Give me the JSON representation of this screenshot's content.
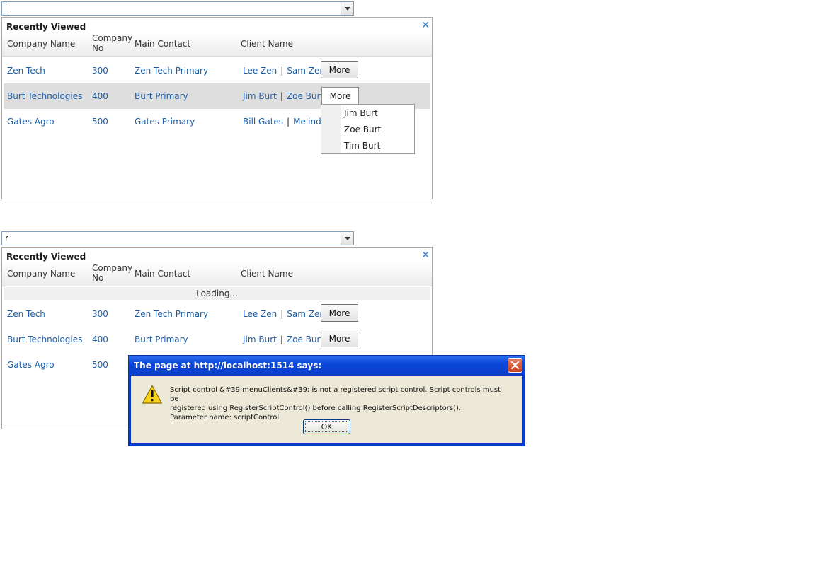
{
  "panel_top": {
    "search": {
      "value": ""
    },
    "title": "Recently Viewed",
    "columns": [
      "Company Name",
      "Company No",
      "Main Contact",
      "Client Name"
    ],
    "rows": [
      {
        "company": "Zen Tech",
        "no": "300",
        "contact": "Zen Tech Primary",
        "client1": "Lee Zen",
        "client2": "Sam Zen",
        "more": "More"
      },
      {
        "company": "Burt Technologies",
        "no": "400",
        "contact": "Burt Primary",
        "client1": "Jim Burt",
        "client2": "Zoe Burt",
        "more": "More"
      },
      {
        "company": "Gates Agro",
        "no": "500",
        "contact": "Gates Primary",
        "client1": "Bill Gates",
        "client2": "Melinda G"
      }
    ],
    "menu": [
      "Jim Burt",
      "Zoe Burt",
      "Tim Burt"
    ]
  },
  "panel_bottom": {
    "search": {
      "value": "r"
    },
    "title": "Recently Viewed",
    "columns": [
      "Company Name",
      "Company No",
      "Main Contact",
      "Client Name"
    ],
    "loading": "Loading...",
    "rows": [
      {
        "company": "Zen Tech",
        "no": "300",
        "contact": "Zen Tech Primary",
        "client1": "Lee Zen",
        "client2": "Sam Zen",
        "more": "More"
      },
      {
        "company": "Burt Technologies",
        "no": "400",
        "contact": "Burt Primary",
        "client1": "Jim Burt",
        "client2": "Zoe Burt",
        "more": "More"
      },
      {
        "company": "Gates Agro",
        "no": "500"
      }
    ]
  },
  "dialog": {
    "title": "The page at http://localhost:1514 says:",
    "line1": "Script control &#39;menuClients&#39; is not a registered script control. Script controls must be",
    "line2": "registered using RegisterScriptControl() before calling RegisterScriptDescriptors().",
    "line3": "Parameter name: scriptControl",
    "ok": "OK"
  },
  "icons": {
    "close": "close-x-icon",
    "dropdown": "chevron-down-icon",
    "warning": "warning-icon"
  },
  "colors": {
    "link": "#1c5ea8",
    "selected_row": "#dedede",
    "dialog_title_bar": "#0a46d8",
    "dialog_body": "#ece9d8"
  }
}
